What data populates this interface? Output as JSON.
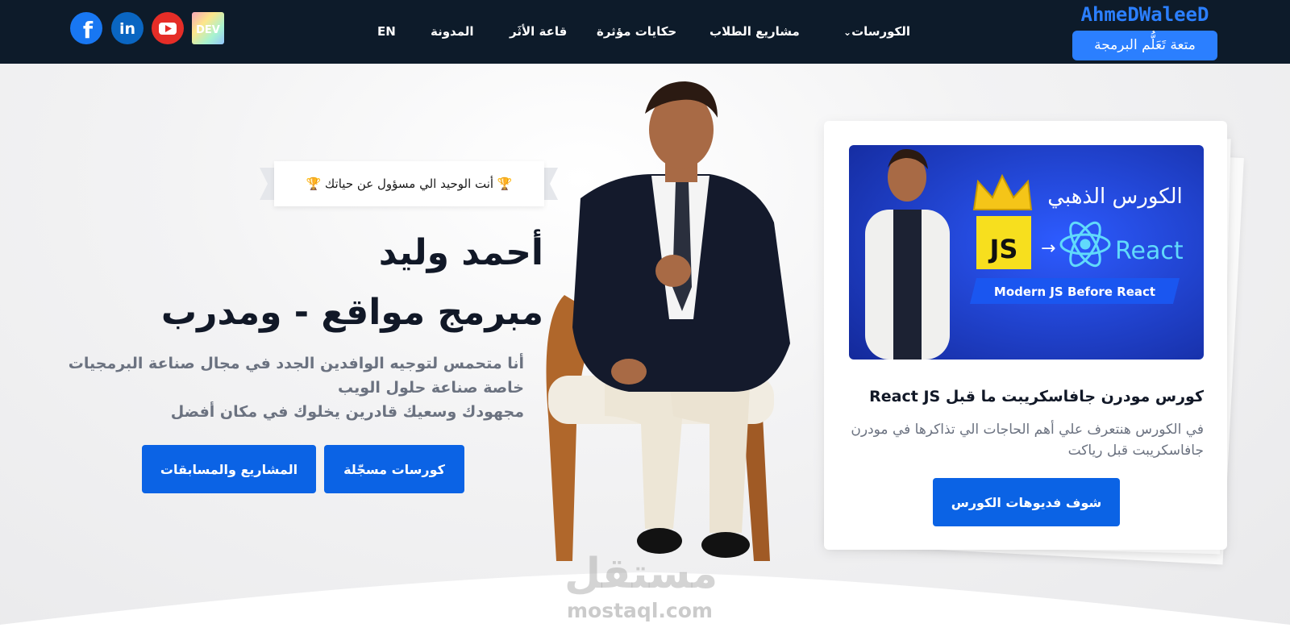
{
  "brand": {
    "name": "AhmeDWaleeD",
    "tagline": "متعة تَعَلُّم البرمجة",
    "color": "#2b7fff"
  },
  "nav": {
    "items": [
      {
        "label": "الكورسات",
        "icon": "chevron-down-icon"
      },
      {
        "label": "مشاريع الطلاب"
      },
      {
        "label": "حكايات مؤثرة"
      },
      {
        "label": "قاعة الأثَر"
      },
      {
        "label": "المدونة"
      },
      {
        "label": "EN"
      }
    ],
    "social": [
      {
        "name": "dev-icon",
        "label": "DEV"
      },
      {
        "name": "youtube-icon"
      },
      {
        "name": "linkedin-icon",
        "label": "in"
      },
      {
        "name": "facebook-icon",
        "label": "f"
      }
    ]
  },
  "hero": {
    "quote": "🏆 أنت الوحيد الي مسؤول عن حياتك 🏆",
    "name": "أحمد وليد",
    "role": "مبرمج مواقع - ومدرب",
    "description_lines": [
      "أنا متحمس لتوجيه الوافدين الجدد في مجال صناعة البرمجيات",
      "خاصة صناعة حلول الويب",
      "مجهودك وسعيك قادرين يخلوك في مكان أفضل"
    ],
    "primary_button": "كورسات مسجّلة",
    "secondary_button": "المشاريع والمسابقات"
  },
  "course_card": {
    "thumbnail": {
      "heading": "الكورس الذهبي",
      "from_badge": "JS",
      "to_label": "React",
      "ribbon": "Modern JS Before React"
    },
    "title": "كورس مودرن جافاسكريبت ما قبل React JS",
    "description": "في الكورس هنتعرف علي أهم الحاجات الي تذاكرها في مودرن جافاسكريبت قبل رياكت",
    "button": "شوف فديوهات الكورس"
  },
  "watermark": {
    "arabic": "مستقل",
    "latin": "mostaql.com"
  },
  "colors": {
    "nav_bg": "#0d1b2a",
    "button": "#0b63e5",
    "js_yellow": "#f7df1e",
    "react_blue": "#61dafb"
  }
}
